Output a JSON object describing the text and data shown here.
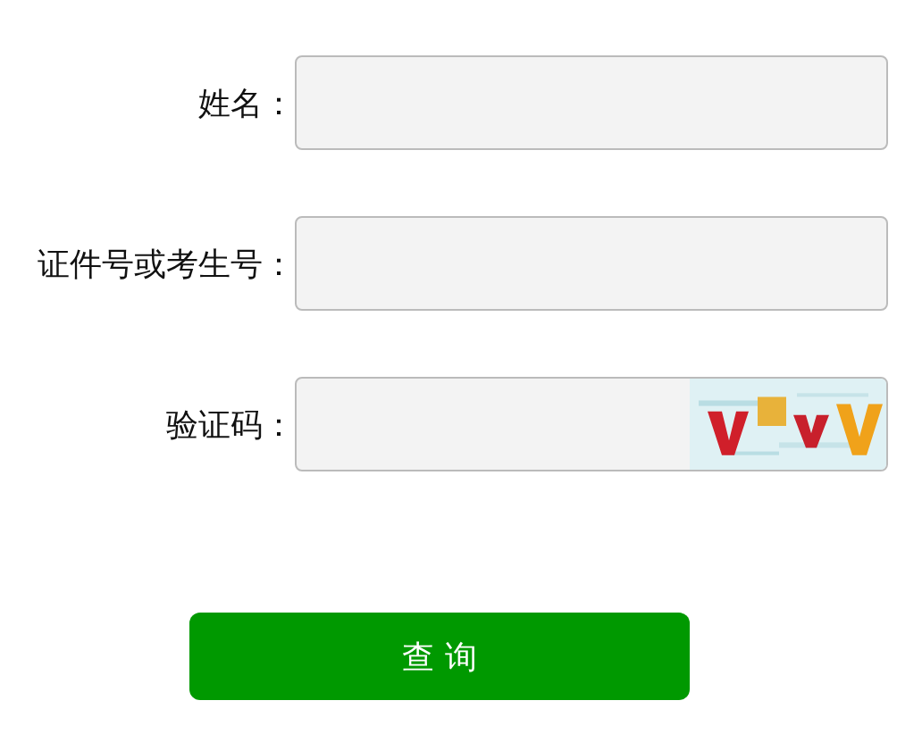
{
  "fields": [
    {
      "label": "姓名：",
      "kind": "text"
    },
    {
      "label": "证件号或考生号：",
      "kind": "text"
    },
    {
      "label": "验证码：",
      "kind": "captcha"
    }
  ],
  "submit_button": "查 询"
}
